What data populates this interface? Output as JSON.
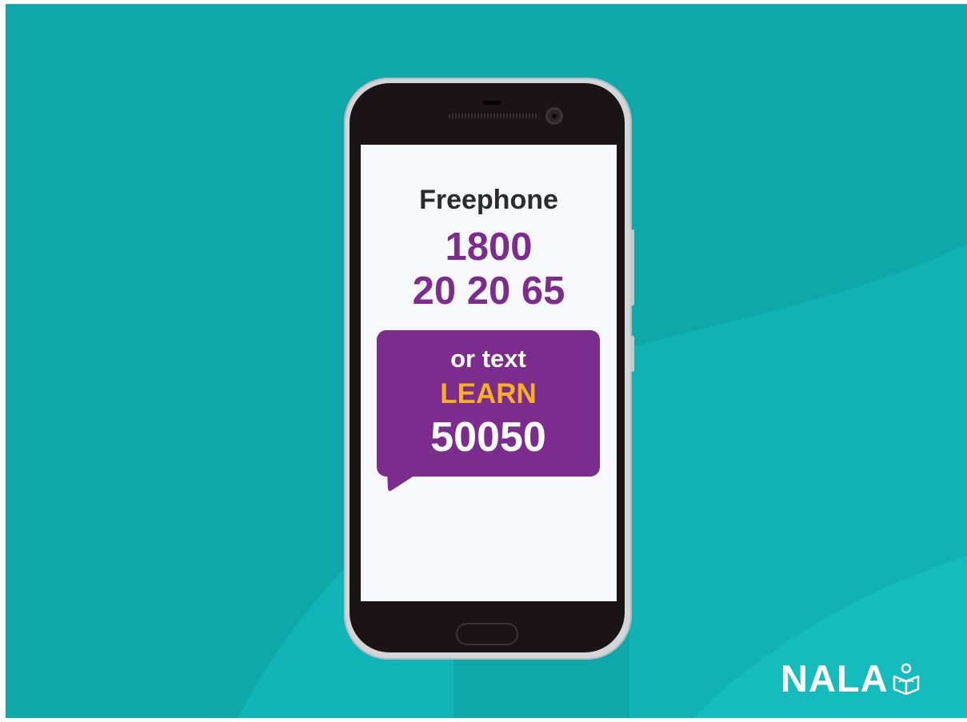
{
  "screen": {
    "heading": "Freephone",
    "phone_line1": "1800",
    "phone_line2": "20 20 65",
    "sms": {
      "prefix": "or text",
      "keyword": "LEARN",
      "shortcode": "50050"
    }
  },
  "logo": {
    "text": "NALA",
    "icon": "reading-person-icon"
  },
  "colors": {
    "background": "#0ea8aa",
    "brand_purple": "#7b2c8d",
    "keyword_yellow": "#f6b021",
    "screen": "#f7f8fb",
    "phone_body": "#1a1416"
  }
}
